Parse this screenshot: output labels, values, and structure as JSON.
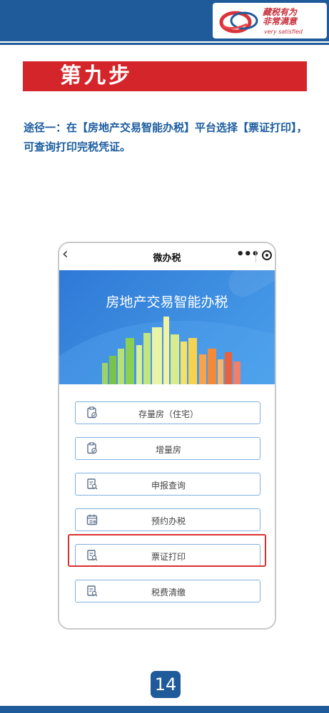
{
  "header": {
    "logo_text_line1": "藏税有为",
    "logo_text_line2": "非常满意",
    "logo_sub": "very satisfied"
  },
  "step": {
    "title": "第九步"
  },
  "description": "途径一：在【房地产交易智能办税】平台选择【票证打印】，可查询打印完税凭证。",
  "phone": {
    "nav": {
      "back_glyph": "‹",
      "title": "微办税",
      "more_glyph": "•••"
    },
    "hero_title": "房地产交易智能办税",
    "menu": [
      {
        "label": "存量房（住宅）",
        "icon": "clipboard-check-icon"
      },
      {
        "label": "增量房",
        "icon": "clipboard-check-icon"
      },
      {
        "label": "申报查询",
        "icon": "document-search-icon"
      },
      {
        "label": "预约办税",
        "icon": "calendar-icon"
      },
      {
        "label": "票证打印",
        "icon": "document-search-icon",
        "highlighted": true
      },
      {
        "label": "税费清缴",
        "icon": "document-search-icon"
      }
    ]
  },
  "page_number": "14",
  "colors": {
    "brand_blue": "#1f5a9a",
    "banner_red": "#d4262a",
    "highlight_red": "#d9302f",
    "text_blue": "#1c5da0"
  }
}
